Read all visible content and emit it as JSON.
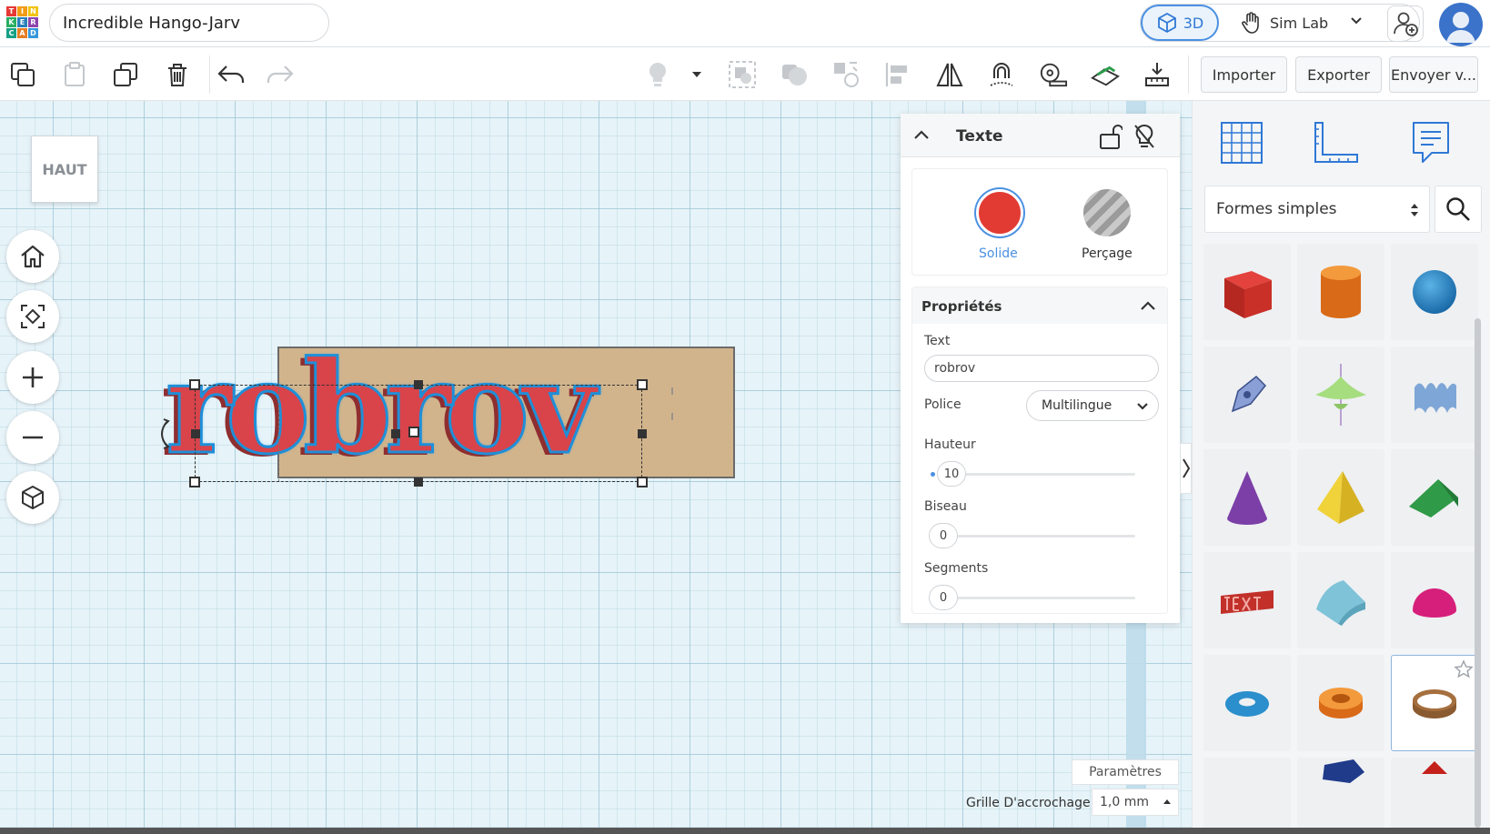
{
  "header": {
    "logo": [
      "T",
      "I",
      "N",
      "K",
      "E",
      "R",
      "C",
      "A",
      "D"
    ],
    "logo_colors": [
      "#e53935",
      "#f39c12",
      "#f1c40f",
      "#27ae60",
      "#2980b9",
      "#8e44ad",
      "#16a085",
      "#e67e22",
      "#3498db"
    ],
    "project_title": "Incredible Hango-Jarv",
    "view_3d_label": "3D",
    "sim_lab_label": "Sim Lab"
  },
  "toolbar": {
    "import_label": "Importer",
    "export_label": "Exporter",
    "send_label": "Envoyer v..."
  },
  "workplane": {
    "view_cube_label": "HAUT",
    "text_object": "robrov",
    "params_label": "Paramètres",
    "snap_label": "Grille D'accrochage",
    "snap_value": "1,0 mm",
    "shape_color": "#d9434a",
    "base_color": "#d2b48c"
  },
  "inspector": {
    "title": "Texte",
    "solid_label": "Solide",
    "hole_label": "Perçage",
    "properties_title": "Propriétés",
    "text_label": "Text",
    "text_value": "robrov",
    "font_label": "Police",
    "font_value": "Multilingue",
    "height_label": "Hauteur",
    "height_value": "10",
    "bevel_label": "Biseau",
    "bevel_value": "0",
    "segments_label": "Segments",
    "segments_value": "0"
  },
  "shapes_panel": {
    "library_label": "Formes simples",
    "shapes": [
      "box",
      "cylinder",
      "sphere",
      "scribble",
      "paraboloid",
      "wave",
      "cone",
      "pyramid",
      "wedge",
      "text",
      "half-cylinder",
      "half-sphere",
      "torus",
      "tube",
      "ring"
    ]
  }
}
